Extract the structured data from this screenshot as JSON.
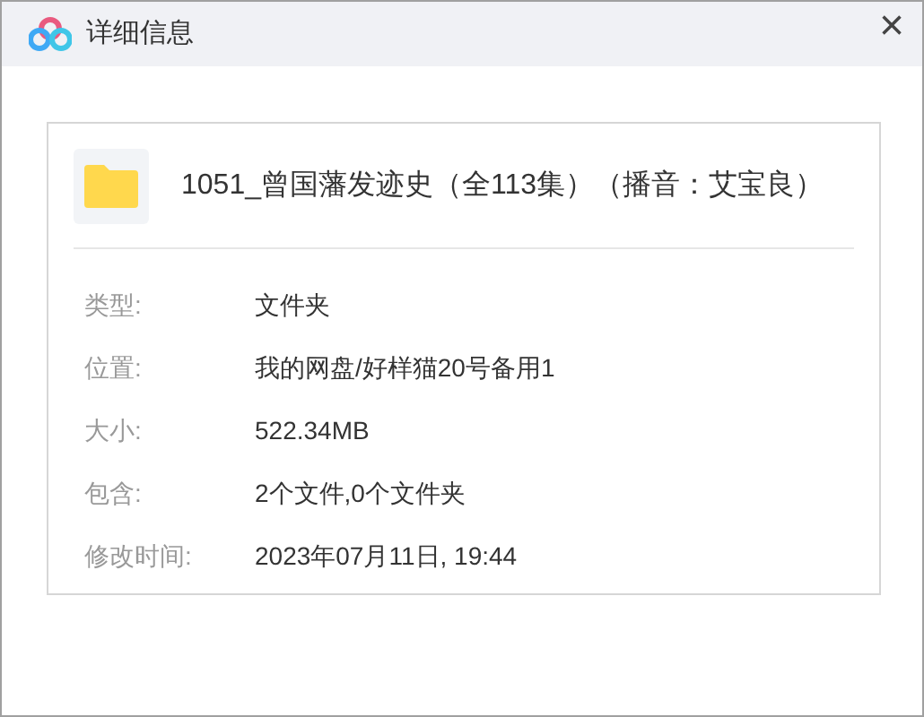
{
  "window": {
    "title": "详细信息",
    "close": "×"
  },
  "file": {
    "name": "1051_曾国藩发迹史（全113集）（播音：艾宝良）"
  },
  "properties": [
    {
      "label": "类型:",
      "value": "文件夹"
    },
    {
      "label": "位置:",
      "value": "我的网盘/好样猫20号备用1"
    },
    {
      "label": "大小:",
      "value": "522.34MB"
    },
    {
      "label": "包含:",
      "value": "2个文件,0个文件夹"
    },
    {
      "label": "修改时间:",
      "value": "2023年07月11日, 19:44"
    }
  ]
}
